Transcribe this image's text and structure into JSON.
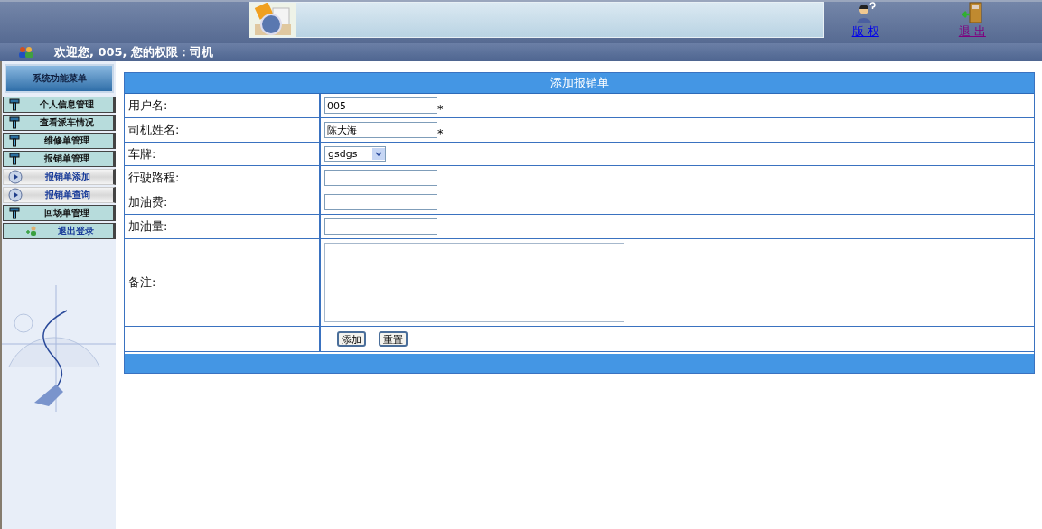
{
  "header": {
    "links": [
      {
        "label": "版 权",
        "kind": "copyright",
        "visited": false
      },
      {
        "label": "退 出",
        "kind": "exit",
        "visited": true
      }
    ]
  },
  "welcome": "欢迎您, 005, 您的权限：司机",
  "sidebar": {
    "title": "系统功能菜单",
    "items": [
      {
        "label": "个人信息管理",
        "kind": "group"
      },
      {
        "label": "查看派车情况",
        "kind": "group"
      },
      {
        "label": "维修单管理",
        "kind": "group"
      },
      {
        "label": "报销单管理",
        "kind": "group"
      },
      {
        "label": "报销单添加",
        "kind": "sub"
      },
      {
        "label": "报销单查询",
        "kind": "sub"
      },
      {
        "label": "回场单管理",
        "kind": "group"
      },
      {
        "label": "退出登录",
        "kind": "logout"
      }
    ]
  },
  "form": {
    "title": "添加报销单",
    "rows": [
      {
        "label": "用户名:",
        "kind": "text",
        "value": "005",
        "required": true
      },
      {
        "label": "司机姓名:",
        "kind": "text",
        "value": "陈大海",
        "required": true
      },
      {
        "label": "车牌:",
        "kind": "select",
        "value": "gsdgs"
      },
      {
        "label": "行驶路程:",
        "kind": "text"
      },
      {
        "label": "加油费:",
        "kind": "text"
      },
      {
        "label": "加油量:",
        "kind": "text"
      },
      {
        "label": "备注:",
        "kind": "textarea"
      }
    ],
    "buttons": [
      "添加",
      "重置"
    ],
    "required_mark": "*"
  }
}
